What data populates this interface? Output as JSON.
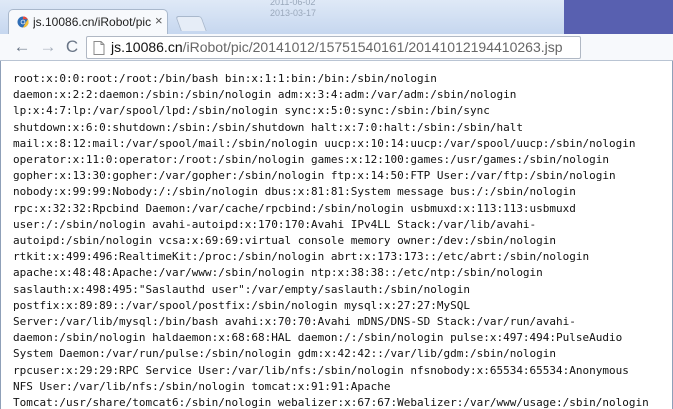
{
  "browser": {
    "background_rows": [
      {
        "a": "",
        "b": "2011-06-02"
      },
      {
        "a": "",
        "b": "2013-03-17"
      }
    ],
    "tab": {
      "title": "js.10086.cn/iRobot/pic/...",
      "close": "×",
      "favicon": "chrome-page-icon"
    },
    "new_tab_icon": "new-tab-icon",
    "toolbar": {
      "back": "←",
      "forward": "→",
      "reload": "C",
      "url_domain": "js.10086.cn",
      "url_path": "/iRobot/pic/20141012/15751540161/20141012194410263.jsp"
    },
    "colors": {
      "accent": "#5860b0",
      "chrome": "#c6d7ef"
    }
  },
  "page": {
    "lines": [
      "root:x:0:0:root:/root:/bin/bash bin:x:1:1:bin:/bin:/sbin/nologin",
      "daemon:x:2:2:daemon:/sbin:/sbin/nologin adm:x:3:4:adm:/var/adm:/sbin/nologin",
      "lp:x:4:7:lp:/var/spool/lpd:/sbin/nologin sync:x:5:0:sync:/sbin:/bin/sync",
      "shutdown:x:6:0:shutdown:/sbin:/sbin/shutdown halt:x:7:0:halt:/sbin:/sbin/halt",
      "mail:x:8:12:mail:/var/spool/mail:/sbin/nologin uucp:x:10:14:uucp:/var/spool/uucp:/sbin/nologin",
      "operator:x:11:0:operator:/root:/sbin/nologin games:x:12:100:games:/usr/games:/sbin/nologin",
      "gopher:x:13:30:gopher:/var/gopher:/sbin/nologin ftp:x:14:50:FTP User:/var/ftp:/sbin/nologin",
      "nobody:x:99:99:Nobody:/:/sbin/nologin dbus:x:81:81:System message bus:/:/sbin/nologin",
      "rpc:x:32:32:Rpcbind Daemon:/var/cache/rpcbind:/sbin/nologin usbmuxd:x:113:113:usbmuxd",
      "user:/:/sbin/nologin avahi-autoipd:x:170:170:Avahi IPv4LL Stack:/var/lib/avahi-",
      "autoipd:/sbin/nologin vcsa:x:69:69:virtual console memory owner:/dev:/sbin/nologin",
      "rtkit:x:499:496:RealtimeKit:/proc:/sbin/nologin abrt:x:173:173::/etc/abrt:/sbin/nologin",
      "apache:x:48:48:Apache:/var/www:/sbin/nologin ntp:x:38:38::/etc/ntp:/sbin/nologin",
      "saslauth:x:498:495:\"Saslauthd user\":/var/empty/saslauth:/sbin/nologin",
      "postfix:x:89:89::/var/spool/postfix:/sbin/nologin mysql:x:27:27:MySQL",
      "Server:/var/lib/mysql:/bin/bash avahi:x:70:70:Avahi mDNS/DNS-SD Stack:/var/run/avahi-",
      "daemon:/sbin/nologin haldaemon:x:68:68:HAL daemon:/:/sbin/nologin pulse:x:497:494:PulseAudio",
      "System Daemon:/var/run/pulse:/sbin/nologin gdm:x:42:42::/var/lib/gdm:/sbin/nologin",
      "rpcuser:x:29:29:RPC Service User:/var/lib/nfs:/sbin/nologin nfsnobody:x:65534:65534:Anonymous",
      "NFS User:/var/lib/nfs:/sbin/nologin tomcat:x:91:91:Apache",
      "Tomcat:/usr/share/tomcat6:/sbin/nologin webalizer:x:67:67:Webalizer:/var/www/usage:/sbin/nologin",
      "sshd:x:74:74:Privilege-separated SSH:/var/empty/sshd:/sbin/nologin"
    ]
  }
}
